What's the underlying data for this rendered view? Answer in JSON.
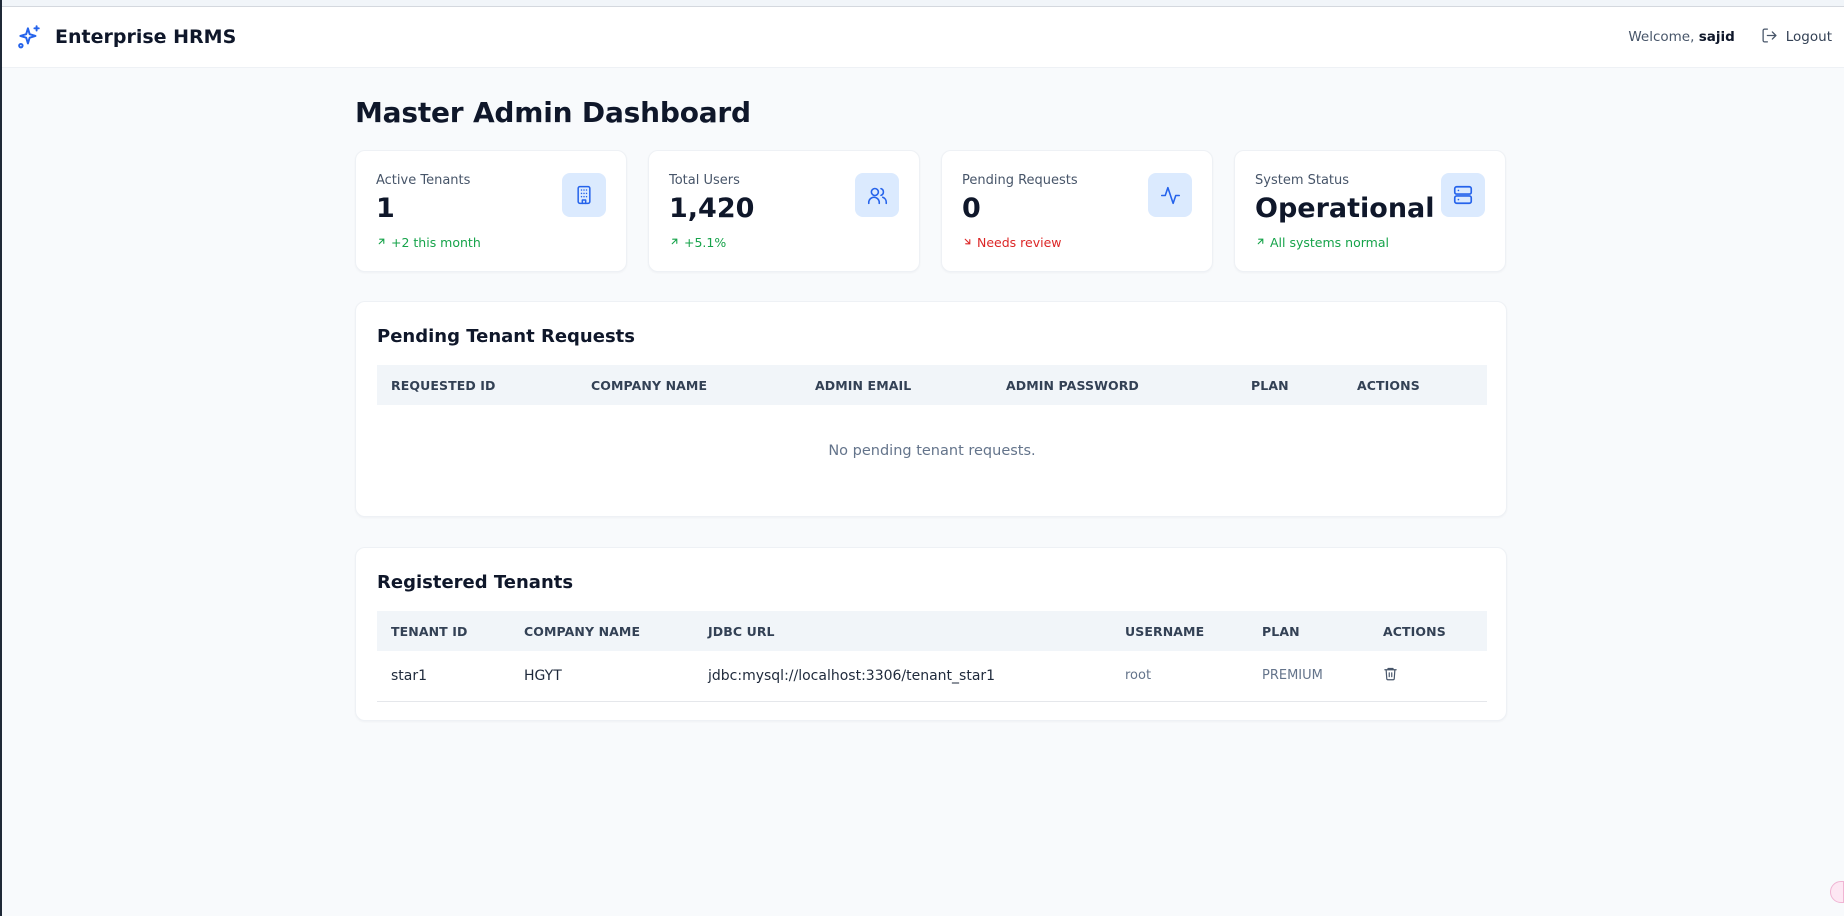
{
  "header": {
    "app_name": "Enterprise HRMS",
    "welcome_prefix": "Welcome, ",
    "username": "sajid",
    "logout_label": "Logout"
  },
  "page": {
    "title": "Master Admin Dashboard"
  },
  "stats": [
    {
      "label": "Active Tenants",
      "value": "1",
      "trend": "+2 this month",
      "trend_dir": "up",
      "icon": "building-icon"
    },
    {
      "label": "Total Users",
      "value": "1,420",
      "trend": "+5.1%",
      "trend_dir": "up",
      "icon": "users-icon"
    },
    {
      "label": "Pending Requests",
      "value": "0",
      "trend": "Needs review",
      "trend_dir": "down",
      "icon": "activity-icon"
    },
    {
      "label": "System Status",
      "value": "Operational",
      "trend": "All systems normal",
      "trend_dir": "up",
      "icon": "server-icon"
    }
  ],
  "pending": {
    "title": "Pending Tenant Requests",
    "columns": [
      "REQUESTED ID",
      "COMPANY NAME",
      "ADMIN EMAIL",
      "ADMIN PASSWORD",
      "PLAN",
      "ACTIONS"
    ],
    "empty_message": "No pending tenant requests."
  },
  "registered": {
    "title": "Registered Tenants",
    "columns": [
      "TENANT ID",
      "COMPANY NAME",
      "JDBC URL",
      "USERNAME",
      "PLAN",
      "ACTIONS"
    ],
    "rows": [
      {
        "tenant_id": "star1",
        "company": "HGYT",
        "jdbc_url": "jdbc:mysql://localhost:3306/tenant_star1",
        "username": "root",
        "plan": "PREMIUM",
        "action_icon": "trash-icon"
      }
    ]
  },
  "colors": {
    "accent": "#2563eb",
    "success": "#16a34a",
    "danger": "#dc2626",
    "icon_bg": "#dbeafe"
  }
}
